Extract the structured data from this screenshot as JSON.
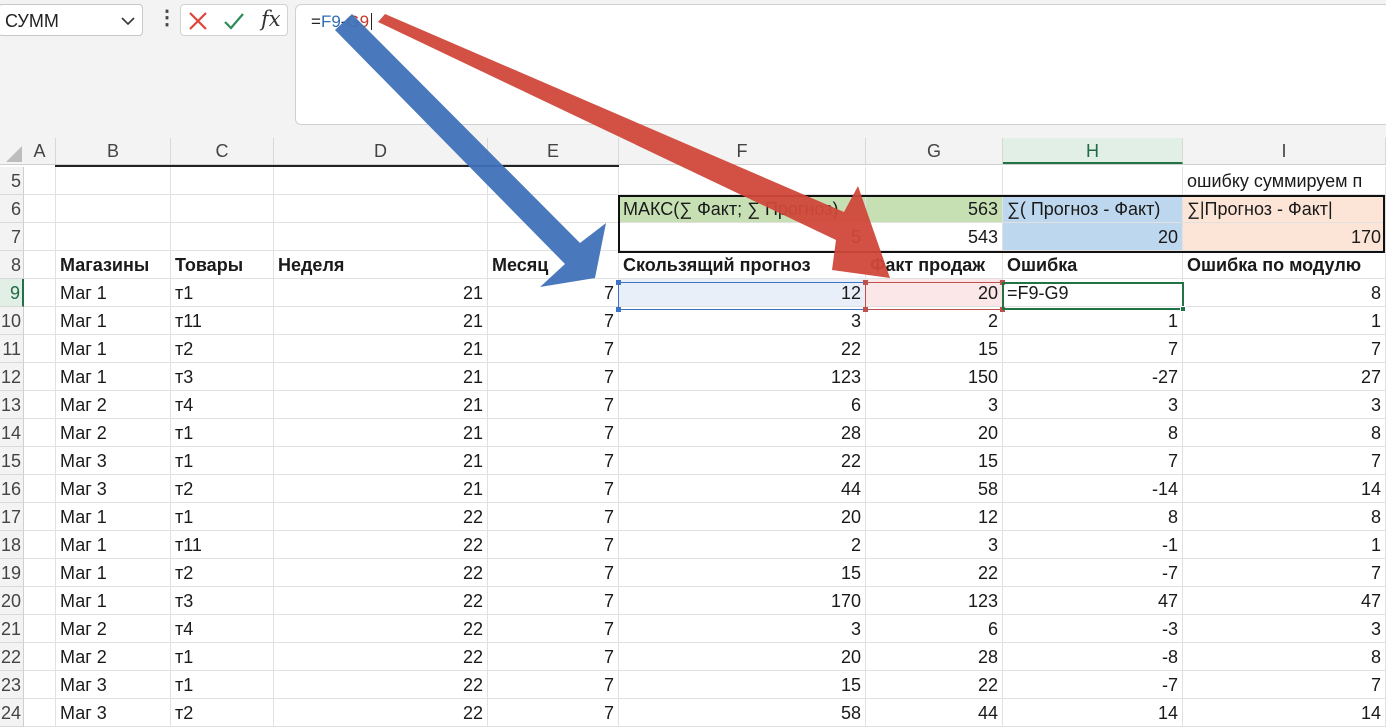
{
  "name_box": {
    "value": "СУММ"
  },
  "formula_bar": {
    "fx_label": "fx",
    "formula_prefix": "=",
    "formula_ref1": "F9",
    "formula_op": "-",
    "formula_ref2": "G9"
  },
  "columns": [
    "A",
    "B",
    "C",
    "D",
    "E",
    "F",
    "G",
    "H",
    "I"
  ],
  "selected_column": "H",
  "rows": {
    "r5": {
      "num": "5",
      "i": "ошибку суммируем п"
    },
    "r6": {
      "num": "6",
      "f": "МАКС(∑ Факт; ∑ Прогноз)",
      "g": "563",
      "h": "∑( Прогноз - Факт)",
      "i": "∑|Прогноз - Факт|"
    },
    "r7": {
      "num": "7",
      "f": "5",
      "g": "543",
      "h": "20",
      "i": "170"
    },
    "r8": {
      "num": "8",
      "b": "Магазины",
      "c": "Товары",
      "d": "Неделя",
      "e": "Месяц",
      "f": "Скользящий прогноз",
      "g": "Факт продаж",
      "h": "Ошибка",
      "i": "Ошибка по модулю"
    },
    "r9": {
      "num": "9",
      "edit": "=F9-G9"
    }
  },
  "table": [
    [
      "9",
      "Маг 1",
      "т1",
      "21",
      "7",
      "12",
      "20",
      "",
      "8"
    ],
    [
      "10",
      "Маг 1",
      "т11",
      "21",
      "7",
      "3",
      "2",
      "1",
      "1"
    ],
    [
      "11",
      "Маг 1",
      "т2",
      "21",
      "7",
      "22",
      "15",
      "7",
      "7"
    ],
    [
      "12",
      "Маг 1",
      "т3",
      "21",
      "7",
      "123",
      "150",
      "-27",
      "27"
    ],
    [
      "13",
      "Маг 2",
      "т4",
      "21",
      "7",
      "6",
      "3",
      "3",
      "3"
    ],
    [
      "14",
      "Маг 2",
      "т1",
      "21",
      "7",
      "28",
      "20",
      "8",
      "8"
    ],
    [
      "15",
      "Маг 3",
      "т1",
      "21",
      "7",
      "22",
      "15",
      "7",
      "7"
    ],
    [
      "16",
      "Маг 3",
      "т2",
      "21",
      "7",
      "44",
      "58",
      "-14",
      "14"
    ],
    [
      "17",
      "Маг 1",
      "т1",
      "22",
      "7",
      "20",
      "12",
      "8",
      "8"
    ],
    [
      "18",
      "Маг 1",
      "т11",
      "22",
      "7",
      "2",
      "3",
      "-1",
      "1"
    ],
    [
      "19",
      "Маг 1",
      "т2",
      "22",
      "7",
      "15",
      "22",
      "-7",
      "7"
    ],
    [
      "20",
      "Маг 1",
      "т3",
      "22",
      "7",
      "170",
      "123",
      "47",
      "47"
    ],
    [
      "21",
      "Маг 2",
      "т4",
      "22",
      "7",
      "3",
      "6",
      "-3",
      "3"
    ],
    [
      "22",
      "Маг 2",
      "т1",
      "22",
      "7",
      "20",
      "28",
      "-8",
      "8"
    ],
    [
      "23",
      "Маг 3",
      "т1",
      "22",
      "7",
      "15",
      "22",
      "-7",
      "7"
    ],
    [
      "24",
      "Маг 3",
      "т2",
      "22",
      "7",
      "58",
      "44",
      "14",
      "14"
    ]
  ],
  "colors": {
    "ref_f": "#2e6fb4",
    "ref_g": "#c0392b",
    "selection": "#217346",
    "header_green": "#c6e0b4",
    "header_blue": "#bdd7ee",
    "header_peach": "#fce4d6",
    "arrow_blue": "#3f72b8",
    "arrow_red": "#d0483a"
  }
}
